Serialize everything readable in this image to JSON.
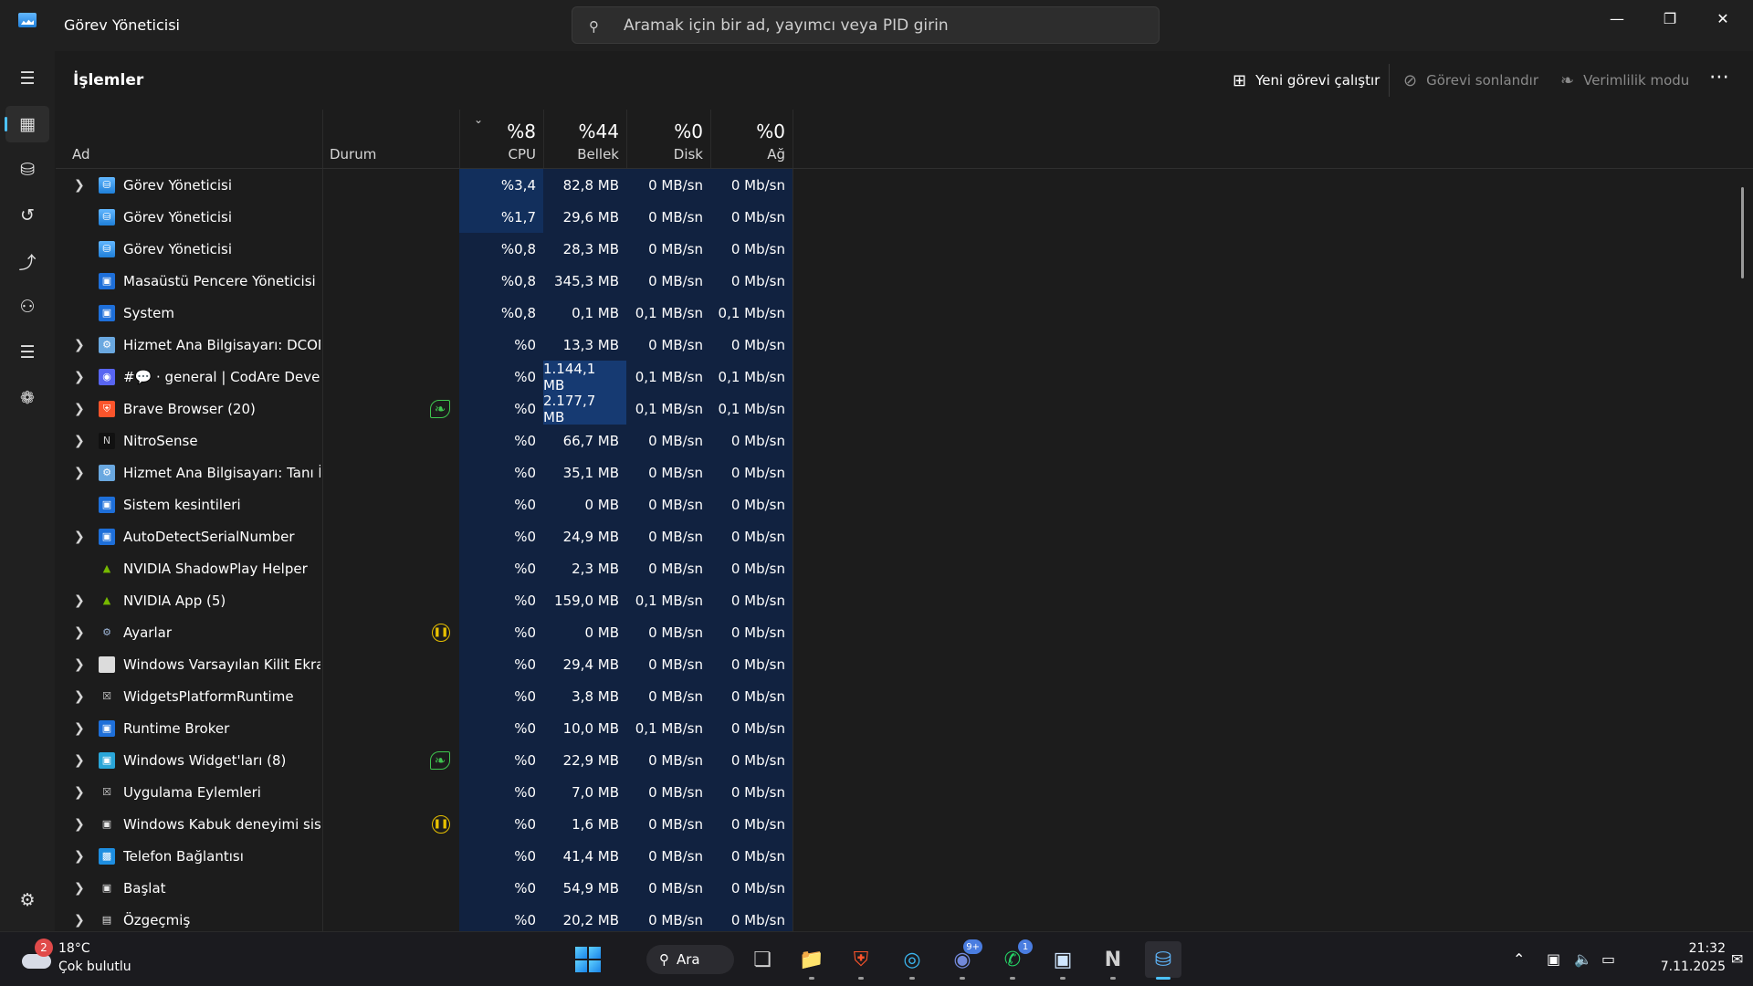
{
  "window": {
    "title": "Görev Yöneticisi",
    "search_placeholder": "Aramak için bir ad, yayımcı veya PID girin",
    "controls": [
      "minimize",
      "restore",
      "close"
    ]
  },
  "nav": {
    "items": [
      {
        "name": "menu",
        "icon": "hamburger-icon"
      },
      {
        "name": "processes",
        "icon": "processes-icon",
        "active": true
      },
      {
        "name": "performance",
        "icon": "performance-icon"
      },
      {
        "name": "app-history",
        "icon": "history-icon"
      },
      {
        "name": "startup-apps",
        "icon": "startup-icon"
      },
      {
        "name": "users",
        "icon": "users-icon"
      },
      {
        "name": "details",
        "icon": "details-icon"
      },
      {
        "name": "services",
        "icon": "services-icon"
      },
      {
        "name": "settings",
        "icon": "gear-icon"
      }
    ]
  },
  "page": {
    "title": "İşlemler"
  },
  "toolbar": {
    "new_task": "Yeni görevi çalıştır",
    "end_task": "Görevi sonlandır",
    "efficiency": "Verimlilik modu"
  },
  "columns": {
    "name": "Ad",
    "status": "Durum",
    "cpu": {
      "pct": "%8",
      "label": "CPU"
    },
    "memory": {
      "pct": "%44",
      "label": "Bellek"
    },
    "disk": {
      "pct": "%0",
      "label": "Disk"
    },
    "network": {
      "pct": "%0",
      "label": "Ağ"
    }
  },
  "processes": [
    {
      "name": "Görev Yöneticisi",
      "expand": true,
      "icon": "taskmgr",
      "status": "",
      "cpu": "%3,4",
      "mem": "82,8 MB",
      "disk": "0 MB/sn",
      "net": "0 Mb/sn"
    },
    {
      "name": "Görev Yöneticisi",
      "expand": false,
      "icon": "taskmgr",
      "status": "",
      "cpu": "%1,7",
      "mem": "29,6 MB",
      "disk": "0 MB/sn",
      "net": "0 Mb/sn"
    },
    {
      "name": "Görev Yöneticisi",
      "expand": false,
      "icon": "taskmgr",
      "status": "",
      "cpu": "%0,8",
      "mem": "28,3 MB",
      "disk": "0 MB/sn",
      "net": "0 Mb/sn"
    },
    {
      "name": "Masaüstü Pencere Yöneticisi",
      "expand": false,
      "icon": "window",
      "status": "",
      "cpu": "%0,8",
      "mem": "345,3 MB",
      "disk": "0 MB/sn",
      "net": "0 Mb/sn"
    },
    {
      "name": "System",
      "expand": false,
      "icon": "window",
      "status": "",
      "cpu": "%0,8",
      "mem": "0,1 MB",
      "disk": "0,1 MB/sn",
      "net": "0,1 Mb/sn"
    },
    {
      "name": "Hizmet Ana Bilgisayarı: DCOM...",
      "expand": true,
      "icon": "gear",
      "status": "",
      "cpu": "%0",
      "mem": "13,3 MB",
      "disk": "0 MB/sn",
      "net": "0 Mb/sn"
    },
    {
      "name": "#💬 · general | CodAre Develo...",
      "expand": true,
      "icon": "discord",
      "status": "",
      "cpu": "%0",
      "mem": "1.144,1 MB",
      "disk": "0,1 MB/sn",
      "net": "0,1 Mb/sn"
    },
    {
      "name": "Brave Browser (20)",
      "expand": true,
      "icon": "brave",
      "status": "efficiency",
      "cpu": "%0",
      "mem": "2.177,7 MB",
      "disk": "0,1 MB/sn",
      "net": "0,1 Mb/sn"
    },
    {
      "name": "NitroSense",
      "expand": true,
      "icon": "nitro",
      "status": "",
      "cpu": "%0",
      "mem": "66,7 MB",
      "disk": "0 MB/sn",
      "net": "0 Mb/sn"
    },
    {
      "name": "Hizmet Ana Bilgisayarı: Tanı İlk...",
      "expand": true,
      "icon": "gear",
      "status": "",
      "cpu": "%0",
      "mem": "35,1 MB",
      "disk": "0 MB/sn",
      "net": "0 Mb/sn"
    },
    {
      "name": "Sistem kesintileri",
      "expand": false,
      "icon": "window",
      "status": "",
      "cpu": "%0",
      "mem": "0 MB",
      "disk": "0 MB/sn",
      "net": "0 Mb/sn"
    },
    {
      "name": "AutoDetectSerialNumber",
      "expand": true,
      "icon": "window",
      "status": "",
      "cpu": "%0",
      "mem": "24,9 MB",
      "disk": "0 MB/sn",
      "net": "0 Mb/sn"
    },
    {
      "name": "NVIDIA ShadowPlay Helper",
      "expand": false,
      "icon": "nvidia",
      "status": "",
      "cpu": "%0",
      "mem": "2,3 MB",
      "disk": "0 MB/sn",
      "net": "0 Mb/sn"
    },
    {
      "name": "NVIDIA App (5)",
      "expand": true,
      "icon": "nvidia",
      "status": "",
      "cpu": "%0",
      "mem": "159,0 MB",
      "disk": "0,1 MB/sn",
      "net": "0 Mb/sn"
    },
    {
      "name": "Ayarlar",
      "expand": true,
      "icon": "settings",
      "status": "paused",
      "cpu": "%0",
      "mem": "0 MB",
      "disk": "0 MB/sn",
      "net": "0 Mb/sn"
    },
    {
      "name": "Windows Varsayılan Kilit Ekran...",
      "expand": true,
      "icon": "blank",
      "status": "",
      "cpu": "%0",
      "mem": "29,4 MB",
      "disk": "0 MB/sn",
      "net": "0 Mb/sn"
    },
    {
      "name": "WidgetsPlatformRuntime",
      "expand": true,
      "icon": "boxx",
      "status": "",
      "cpu": "%0",
      "mem": "3,8 MB",
      "disk": "0 MB/sn",
      "net": "0 Mb/sn"
    },
    {
      "name": "Runtime Broker",
      "expand": true,
      "icon": "window",
      "status": "",
      "cpu": "%0",
      "mem": "10,0 MB",
      "disk": "0,1 MB/sn",
      "net": "0 Mb/sn"
    },
    {
      "name": "Windows Widget'ları (8)",
      "expand": true,
      "icon": "widgets",
      "status": "efficiency",
      "cpu": "%0",
      "mem": "22,9 MB",
      "disk": "0 MB/sn",
      "net": "0 Mb/sn"
    },
    {
      "name": "Uygulama Eylemleri",
      "expand": true,
      "icon": "boxx",
      "status": "",
      "cpu": "%0",
      "mem": "7,0 MB",
      "disk": "0 MB/sn",
      "net": "0 Mb/sn"
    },
    {
      "name": "Windows Kabuk deneyimi sist...",
      "expand": true,
      "icon": "shell",
      "status": "paused",
      "cpu": "%0",
      "mem": "1,6 MB",
      "disk": "0 MB/sn",
      "net": "0 Mb/sn"
    },
    {
      "name": "Telefon Bağlantısı",
      "expand": true,
      "icon": "phone",
      "status": "",
      "cpu": "%0",
      "mem": "41,4 MB",
      "disk": "0 MB/sn",
      "net": "0 Mb/sn"
    },
    {
      "name": "Başlat",
      "expand": true,
      "icon": "shell",
      "status": "",
      "cpu": "%0",
      "mem": "54,9 MB",
      "disk": "0 MB/sn",
      "net": "0 Mb/sn"
    },
    {
      "name": "Özgeçmiş",
      "expand": true,
      "icon": "resume",
      "status": "",
      "cpu": "%0",
      "mem": "20,2 MB",
      "disk": "0 MB/sn",
      "net": "0 Mb/sn"
    }
  ],
  "taskbar": {
    "weather": {
      "temp": "18°C",
      "desc": "Çok bulutlu",
      "badge": "2"
    },
    "search_label": "Ara",
    "apps": [
      {
        "name": "start",
        "icon": "windows-start-icon"
      },
      {
        "name": "task-view",
        "icon": "task-view-icon"
      },
      {
        "name": "file-explorer",
        "icon": "folder-icon"
      },
      {
        "name": "brave",
        "icon": "brave-icon"
      },
      {
        "name": "edge",
        "icon": "edge-icon"
      },
      {
        "name": "discord",
        "icon": "discord-icon",
        "badge": "9+"
      },
      {
        "name": "whatsapp",
        "icon": "whatsapp-icon",
        "badge": "1"
      },
      {
        "name": "window-app",
        "icon": "window-icon"
      },
      {
        "name": "nitrosense",
        "icon": "nitro-icon"
      },
      {
        "name": "task-manager",
        "icon": "task-manager-icon",
        "active": true
      }
    ],
    "clock": {
      "time": "21:32",
      "date": "7.11.2025"
    }
  },
  "colors": {
    "accent": "#4cc2ff",
    "heat_cpu_high": "#122f5c",
    "heat_base": "#112240",
    "efficiency_green": "#3fc64f",
    "paused_yellow": "#e8c100"
  }
}
